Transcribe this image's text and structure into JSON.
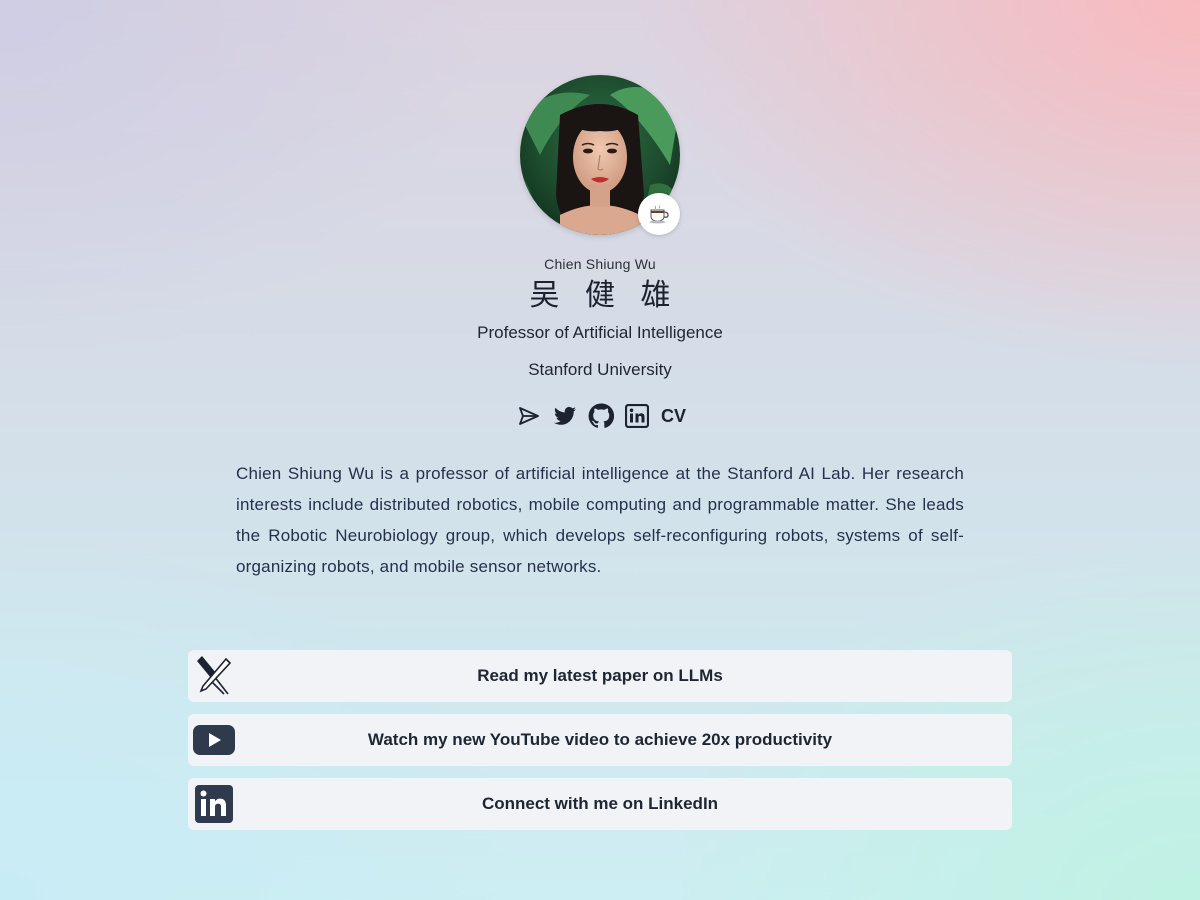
{
  "profile": {
    "name_en": "Chien Shiung Wu",
    "name_zh": "吴 健 雄",
    "title": "Professor of Artificial Intelligence",
    "affiliation": "Stanford University",
    "status_emoji": "☕",
    "bio": "Chien Shiung Wu is a professor of artificial intelligence at the Stanford AI Lab. Her research interests include distributed robotics, mobile computing and programmable matter. She leads the Robotic Neurobiology group, which develops self-reconfiguring robots, systems of self-organizing robots, and mobile sensor networks."
  },
  "socials": {
    "items": [
      {
        "icon": "send-icon"
      },
      {
        "icon": "twitter-icon"
      },
      {
        "icon": "github-icon"
      },
      {
        "icon": "linkedin-icon"
      }
    ],
    "cv_label": "CV"
  },
  "links": [
    {
      "icon": "pen-tool-icon",
      "label": "Read my latest paper on LLMs"
    },
    {
      "icon": "youtube-icon",
      "label": "Watch my new YouTube video to achieve 20x productivity"
    },
    {
      "icon": "linkedin-icon",
      "label": "Connect with me on LinkedIn"
    }
  ],
  "colors": {
    "card_background": "#f1f3f6",
    "text": "#1f2633",
    "icon": "#1d2230"
  }
}
